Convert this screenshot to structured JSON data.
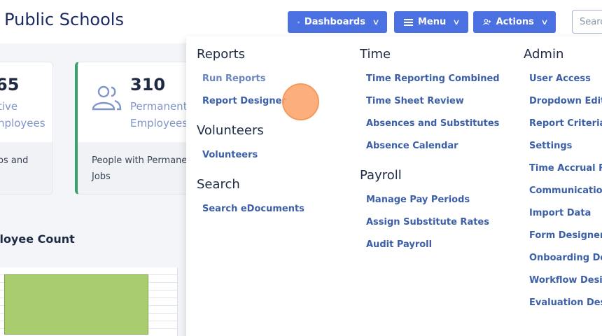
{
  "header": {
    "app_title": "s Public Schools",
    "dashboards_label": "Dashboards",
    "menu_label": "Menu",
    "actions_label": "Actions",
    "search_placeholder": "Search"
  },
  "cards": [
    {
      "number": "65",
      "line1": "tive",
      "line2": "nployees",
      "foot1": "os and",
      "foot2": ""
    },
    {
      "number": "310",
      "line1": "Permanent",
      "line2": "Employees",
      "foot1": "People with Permanen",
      "foot2": "Jobs"
    }
  ],
  "chart": {
    "title": "ployee Count"
  },
  "dropdown": {
    "reports": {
      "heading": "Reports",
      "items": [
        "Run Reports",
        "Report Designer"
      ]
    },
    "volunteers": {
      "heading": "Volunteers",
      "items": [
        "Volunteers"
      ]
    },
    "search": {
      "heading": "Search",
      "items": [
        "Search eDocuments"
      ]
    },
    "time": {
      "heading": "Time",
      "items": [
        "Time Reporting Combined",
        "Time Sheet Review",
        "Absences and Substitutes",
        "Absence Calendar"
      ]
    },
    "payroll": {
      "heading": "Payroll",
      "items": [
        "Manage Pay Periods",
        "Assign Substitute Rates",
        "Audit Payroll"
      ]
    },
    "admin": {
      "heading": "Admin",
      "items": [
        "User Access",
        "Dropdown Edits",
        "Report Criteria",
        "Settings",
        "Time Accrual Rule",
        "Communications",
        "Import Data",
        "Form Designer",
        "Onboarding Desig",
        "Workflow Design",
        "Evaluation Design"
      ]
    }
  },
  "colors": {
    "primary_button": "#4b70e2",
    "menu_link": "#3c5fa7",
    "accent_green": "#38a169",
    "cursor": "#fca066"
  }
}
